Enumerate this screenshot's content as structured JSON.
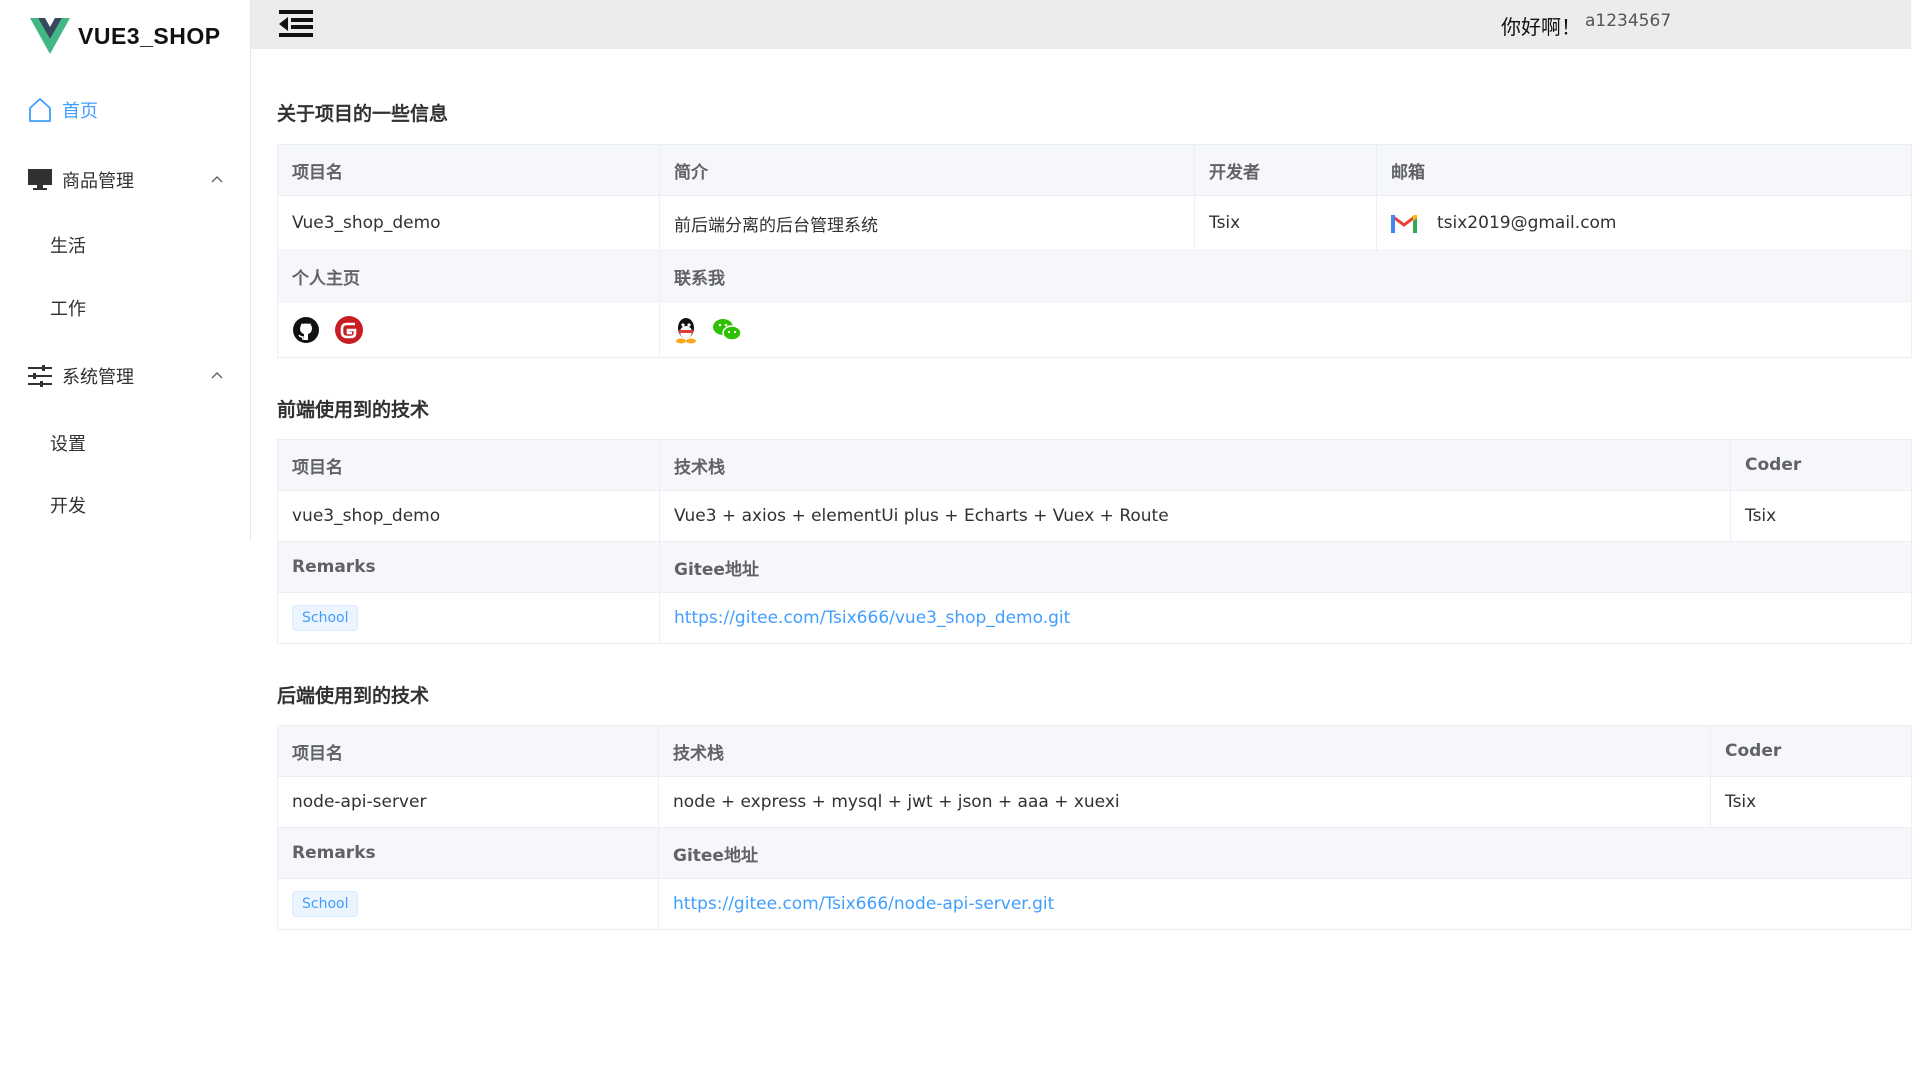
{
  "brand": {
    "name": "VUE3_SHOP",
    "logo_icon": "vue-logo-icon",
    "logo_color": "#41b883"
  },
  "sidebar": {
    "home": {
      "label": "首页",
      "icon": "home-icon"
    },
    "goods": {
      "label": "商品管理",
      "icon": "monitor-icon",
      "children": [
        {
          "label": "生活"
        },
        {
          "label": "工作"
        }
      ]
    },
    "system": {
      "label": "系统管理",
      "icon": "sliders-icon",
      "children": [
        {
          "label": "设置"
        },
        {
          "label": "开发"
        }
      ]
    }
  },
  "header": {
    "greeting": "你好啊！",
    "username": "a1234567",
    "menu_icon": "fold-menu-icon"
  },
  "about": {
    "title": "关于项目的一些信息",
    "headers": {
      "name": "项目名",
      "intro": "简介",
      "dev": "开发者",
      "email": "邮箱"
    },
    "values": {
      "name": "Vue3_shop_demo",
      "intro": "前后端分离的后台管理系统",
      "dev": "Tsix",
      "email": "tsix2019@gmail.com"
    },
    "headers2": {
      "homepage": "个人主页",
      "contact": "联系我"
    },
    "homepage_icons": [
      "github-icon",
      "gitee-icon"
    ],
    "contact_icons": [
      "qq-icon",
      "wechat-icon"
    ]
  },
  "frontend": {
    "title": "前端使用到的技术",
    "headers": {
      "name": "项目名",
      "stack": "技术栈",
      "coder": "Coder"
    },
    "values": {
      "name": "vue3_shop_demo",
      "stack": "Vue3 + axios + elementUi plus + Echarts + Vuex + Route",
      "coder": "Tsix"
    },
    "headers2": {
      "remarks": "Remarks",
      "gitee": "Gitee地址"
    },
    "tag": "School",
    "url": "https://gitee.com/Tsix666/vue3_shop_demo.git"
  },
  "backend": {
    "title": "后端使用到的技术",
    "headers": {
      "name": "项目名",
      "stack": "技术栈",
      "coder": "Coder"
    },
    "values": {
      "name": "node-api-server",
      "stack": "node + express + mysql + jwt + json + aaa + xuexi",
      "coder": "Tsix"
    },
    "headers2": {
      "remarks": "Remarks",
      "gitee": "Gitee地址"
    },
    "tag": "School",
    "url": "https://gitee.com/Tsix666/node-api-server.git"
  },
  "colors": {
    "accent": "#409eff",
    "green": "#67c23a",
    "header_bg": "#ececec",
    "label_bg": "#f5f7fa"
  }
}
